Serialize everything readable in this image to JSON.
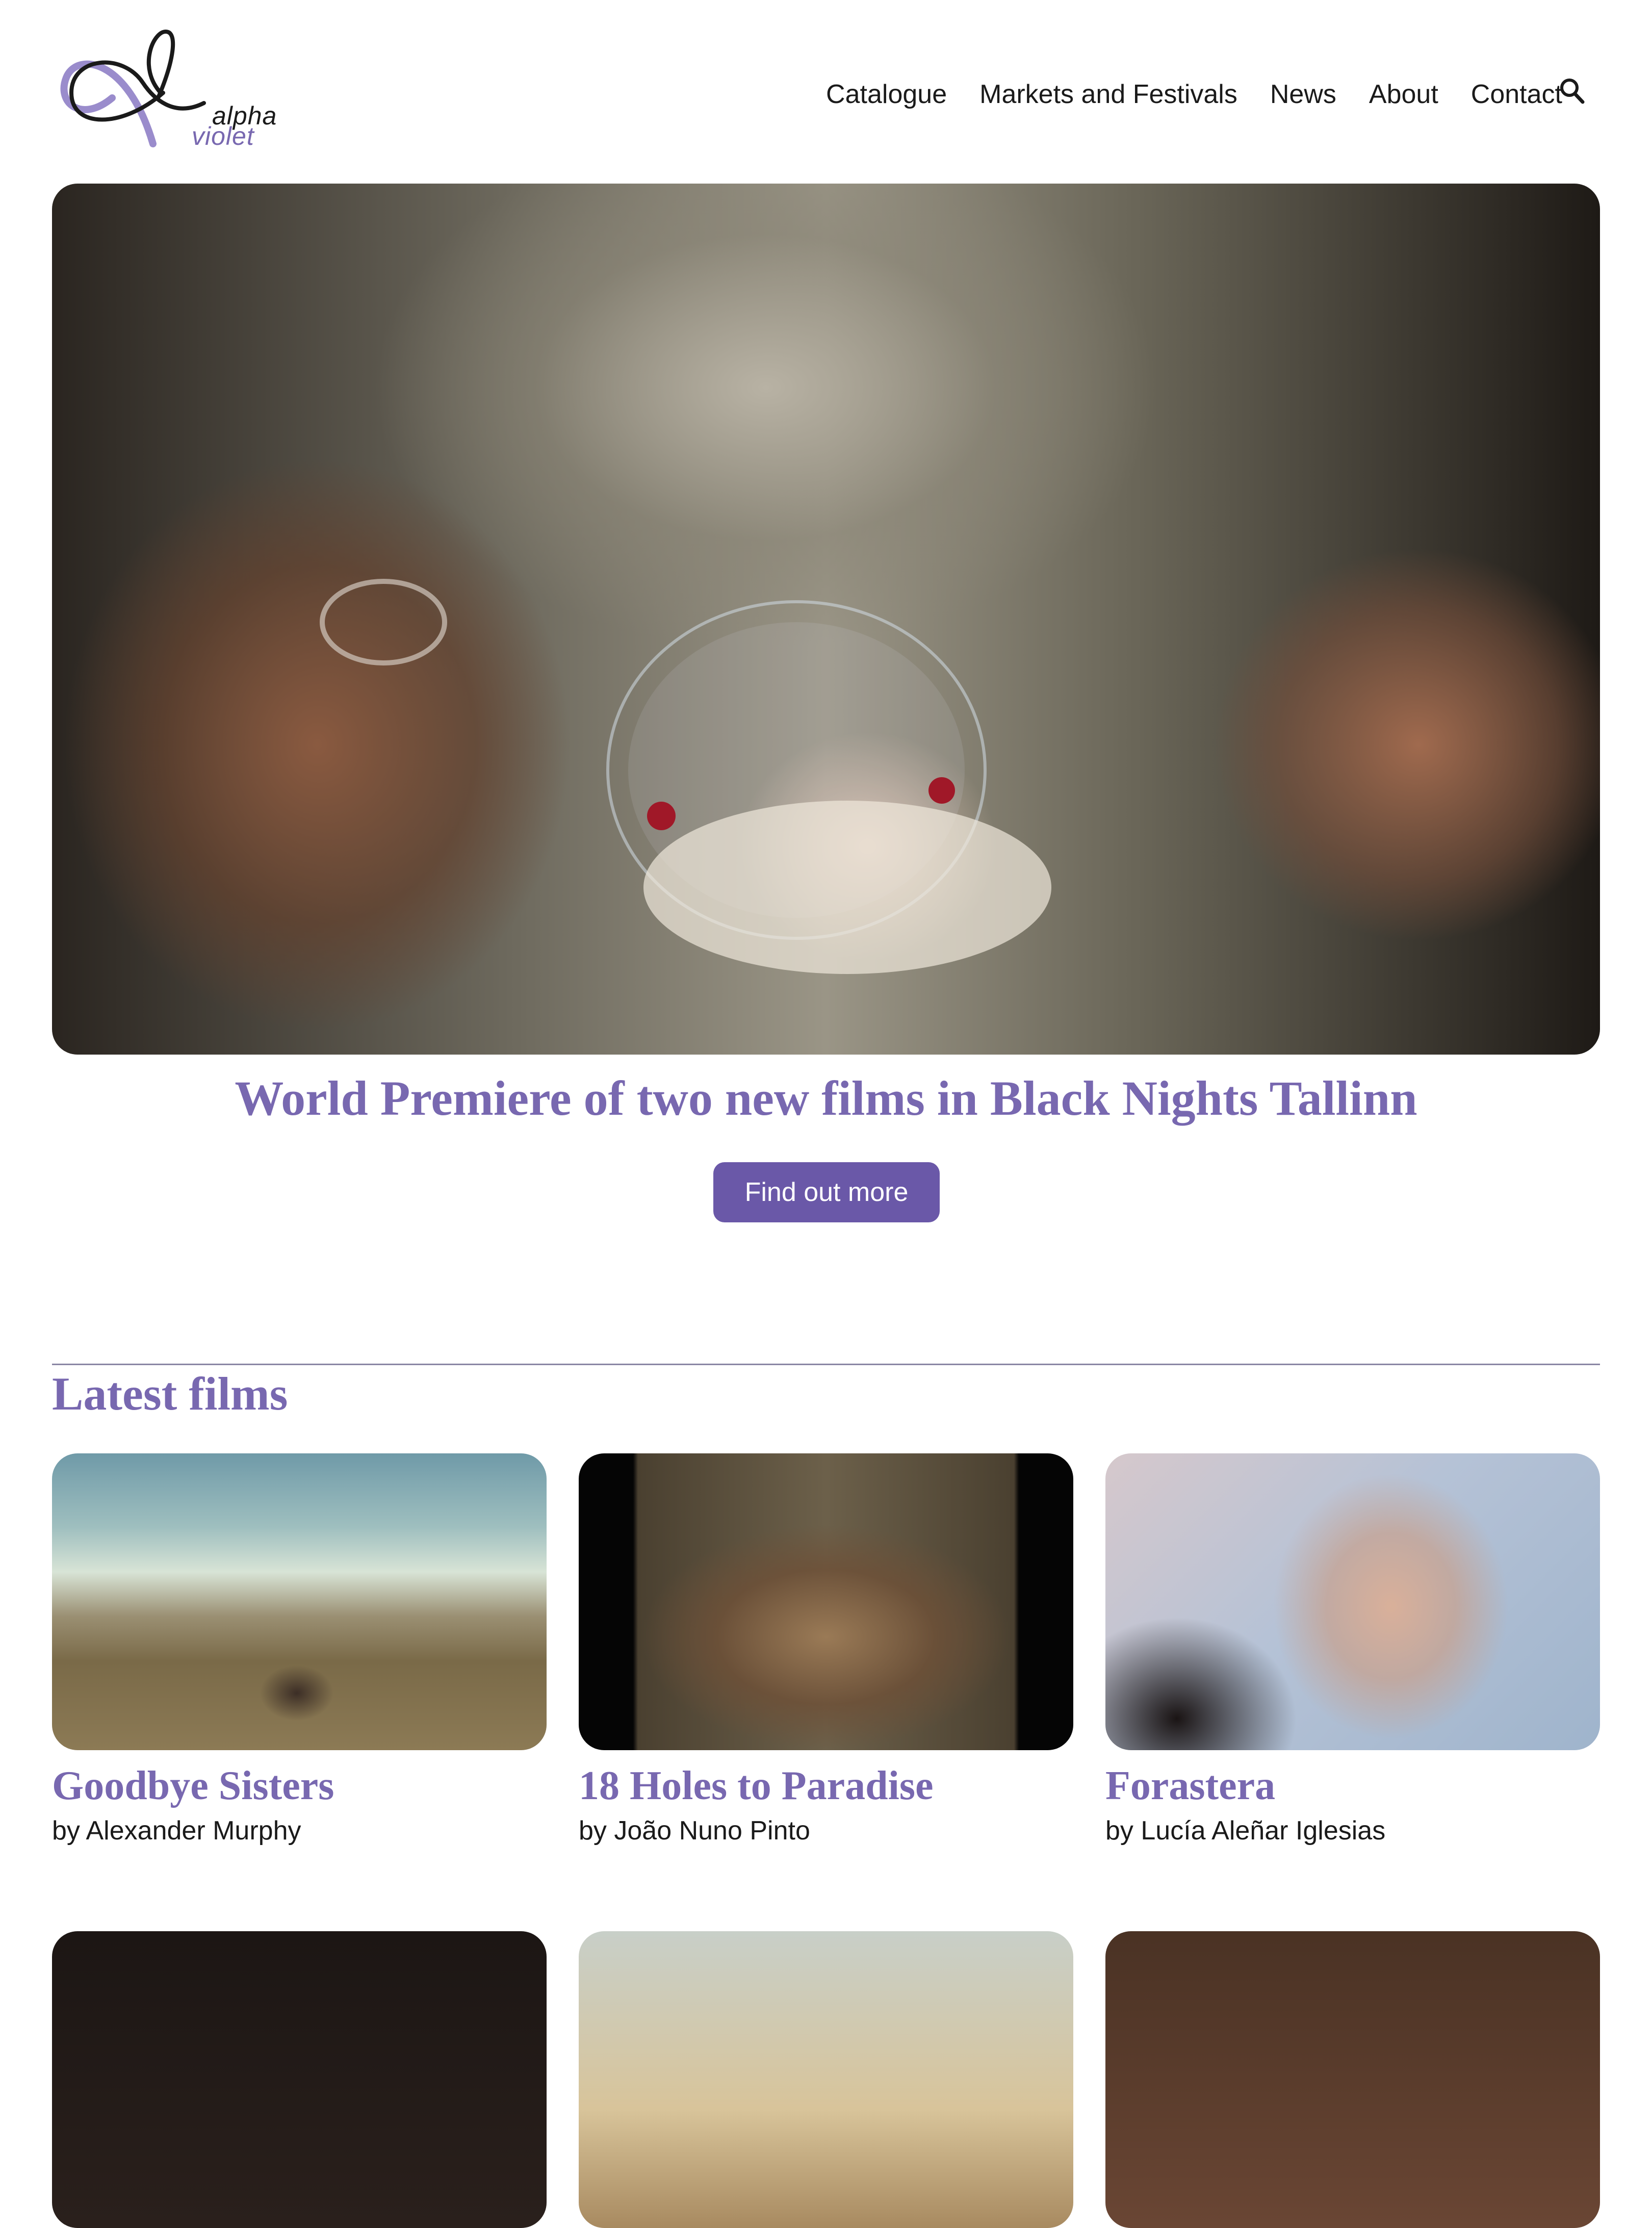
{
  "brand": {
    "logo_name": "alpha violet logo",
    "word1": "alpha",
    "word2": "violet",
    "colors": {
      "accent": "#7868b0",
      "button": "#6a58a8",
      "text": "#1a1a1a"
    }
  },
  "nav": {
    "items": [
      {
        "label": "Catalogue"
      },
      {
        "label": "Markets and Festivals"
      },
      {
        "label": "News"
      },
      {
        "label": "About"
      },
      {
        "label": "Contact"
      }
    ],
    "search_icon": "search-icon"
  },
  "hero": {
    "image": "film still: two women blowing a soap bubble",
    "caption": "World Premiere of two new films in Black Nights Tallinn",
    "button_label": "Find out more"
  },
  "latest": {
    "title": "Latest films",
    "films": [
      {
        "title": "Goodbye Sisters",
        "director": "by Alexander Murphy"
      },
      {
        "title": "18 Holes to Paradise",
        "director": "by João Nuno Pinto"
      },
      {
        "title": "Forastera",
        "director": "by Lucía Aleñar Iglesias"
      }
    ]
  }
}
